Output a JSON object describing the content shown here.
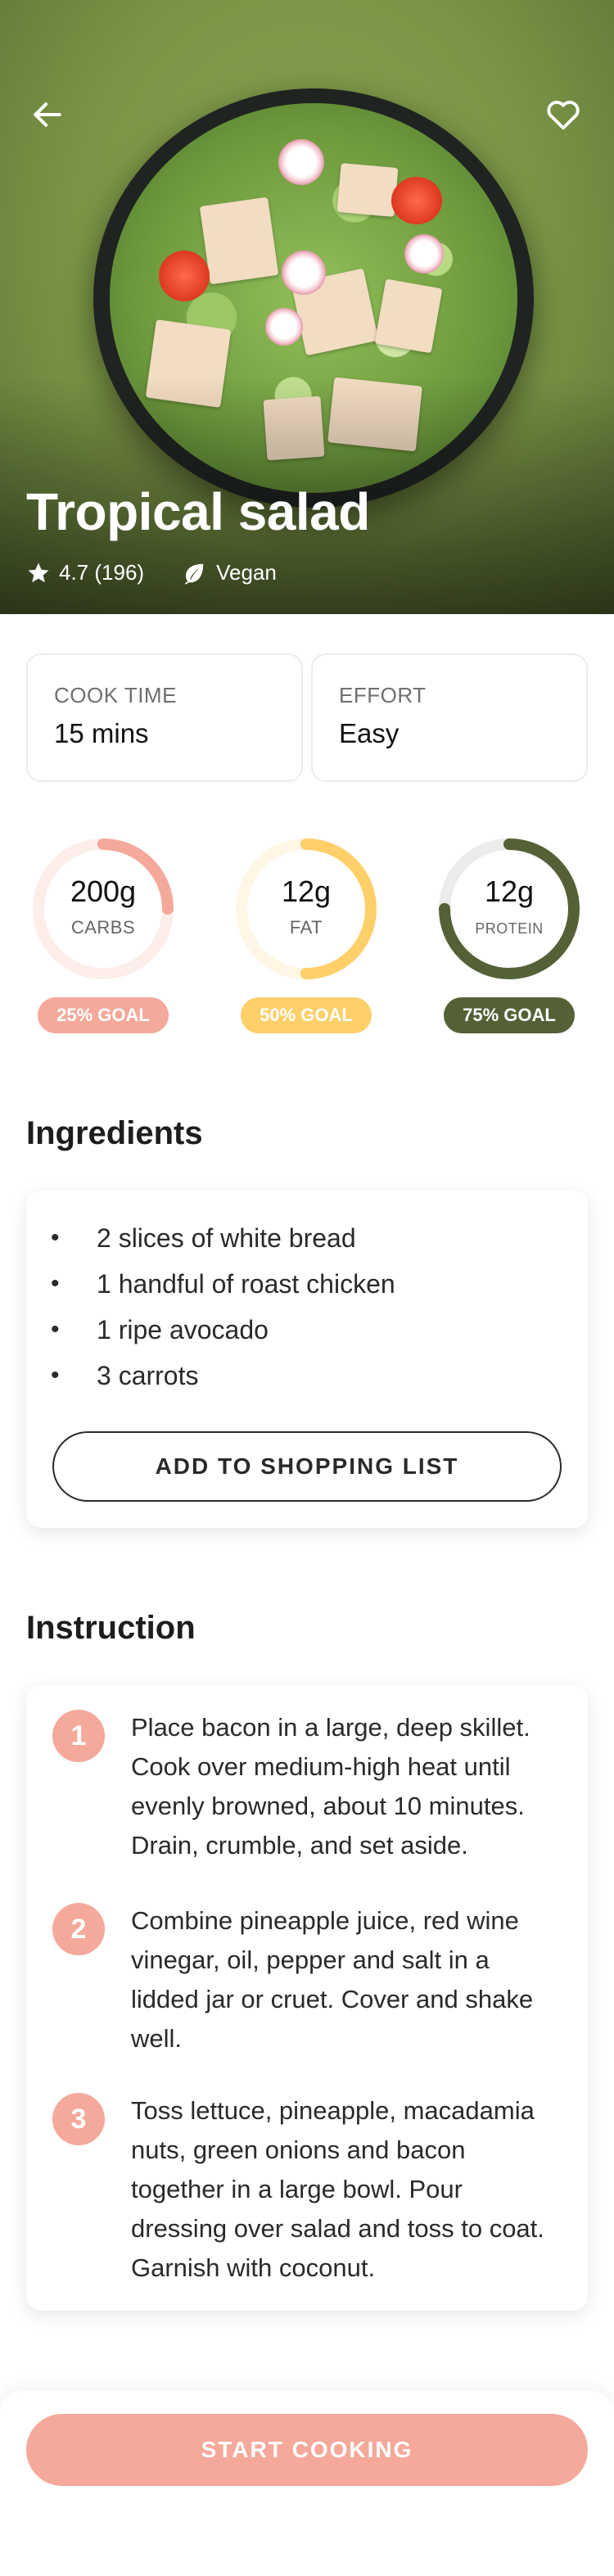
{
  "recipe": {
    "title": "Tropical salad",
    "rating": "4.7 (196)",
    "diet": "Vegan"
  },
  "icons": {
    "back": "arrow-left-icon",
    "favorite": "heart-outline-icon",
    "rating": "star-icon",
    "diet": "leaf-icon"
  },
  "info": {
    "cook_time_label": "COOK TIME",
    "cook_time_value": "15 mins",
    "effort_label": "EFFORT",
    "effort_value": "Easy"
  },
  "nutrition": [
    {
      "value": "200g",
      "unit": "CARBS",
      "goal": "25% GOAL",
      "fraction": 0.25,
      "color": "#f4a99b",
      "track": "#fdeeea"
    },
    {
      "value": "12g",
      "unit": "FAT",
      "goal": "50% GOAL",
      "fraction": 0.5,
      "color": "#ffcf6a",
      "track": "#fff6e6"
    },
    {
      "value": "12g",
      "unit": "PROTEIN",
      "goal": "75% GOAL",
      "fraction": 0.75,
      "color": "#546136",
      "track": "#ececea"
    }
  ],
  "ingredients": {
    "title": "Ingredients",
    "items": [
      "2 slices of white bread",
      "1 handful of roast chicken",
      "1 ripe avocado",
      "3 carrots"
    ],
    "bullet": "•",
    "add_button": "ADD TO SHOPPING LIST"
  },
  "instruction": {
    "title": "Instruction",
    "steps": [
      {
        "num": "1",
        "text": "Place bacon in a large, deep skillet. Cook over medium-high heat until evenly browned, about 10 minutes. Drain, crumble, and set aside."
      },
      {
        "num": "2",
        "text": "Combine pineapple juice, red wine vinegar, oil, pepper and salt in a lidded jar or cruet. Cover and shake well."
      },
      {
        "num": "3",
        "text": "Toss lettuce, pineapple, macadamia nuts, green onions and bacon together in a large bowl. Pour dressing over salad and toss to coat. Garnish with coconut."
      }
    ]
  },
  "cta": {
    "start": "START COOKING"
  },
  "colors": {
    "accent": "#f4a99b",
    "fat": "#ffcf6a",
    "protein": "#546136"
  }
}
